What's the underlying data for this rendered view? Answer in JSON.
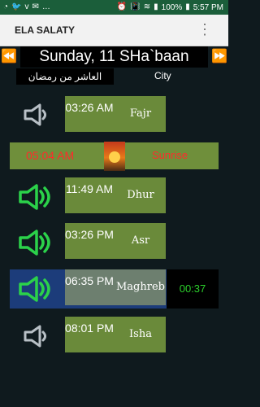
{
  "status_bar": {
    "icons": [
      "whatsapp-icon",
      "twitter-icon",
      "vimeo-icon",
      "more-dots"
    ],
    "right_icons": [
      "alarm-icon",
      "vibrate-icon",
      "wifi-icon",
      "signal-icon",
      "battery-icon"
    ],
    "battery": "100%",
    "time": "5:57 PM"
  },
  "app_bar": {
    "title": "ELA SALATY"
  },
  "date_nav": {
    "date_label": "Sunday, 11 SHa`baan",
    "prev_icon": "double-left-arrow",
    "next_icon": "double-right-arrow"
  },
  "hijri_text": "العاشر من رمضان",
  "city_label": "City",
  "prayers": [
    {
      "name": "Fajr",
      "time": "03:26 AM",
      "sound": "speaker-off"
    },
    {
      "name": "Dhur",
      "time": "11:49 AM",
      "sound": "speaker-on"
    },
    {
      "name": "Asr",
      "time": "03:26 PM",
      "sound": "speaker-on"
    },
    {
      "name": "Maghreb",
      "time": "06:35 PM",
      "sound": "speaker-on",
      "countdown": "00:37"
    },
    {
      "name": "Isha",
      "time": "08:01 PM",
      "sound": "speaker-off"
    }
  ],
  "sunrise": {
    "time": "05:04 AM",
    "label": "Sunrise"
  },
  "colors": {
    "status_green": "#1b5e3a",
    "time_box_green": "#6a8a3a",
    "sunrise_text": "#ff2b2b",
    "maghreb_band": "#1c3c7a",
    "countdown_green": "#2bd02b",
    "speaker_on": "#2bd24a",
    "speaker_off": "#b8c0c6"
  }
}
